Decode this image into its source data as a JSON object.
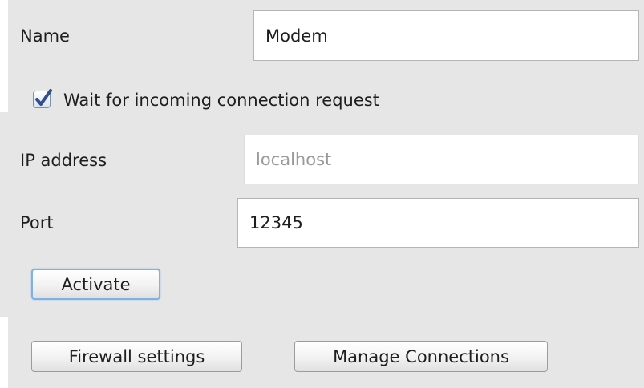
{
  "form": {
    "name_label": "Name",
    "name_value": "Modem",
    "wait_checkbox_label": "Wait for incoming connection request",
    "wait_checkbox_checked": true,
    "ip_label": "IP address",
    "ip_placeholder": "localhost",
    "port_label": "Port",
    "port_value": "12345"
  },
  "buttons": {
    "activate": "Activate",
    "firewall": "Firewall settings",
    "manage": "Manage Connections"
  },
  "icons": {
    "checkbox_mark": "checkmark-icon"
  },
  "colors": {
    "panel_background": "#e6e6e6",
    "checkmark": "#2f4f8f",
    "focus_ring": "#7fb0e6",
    "placeholder_text": "#9a9a9a"
  }
}
